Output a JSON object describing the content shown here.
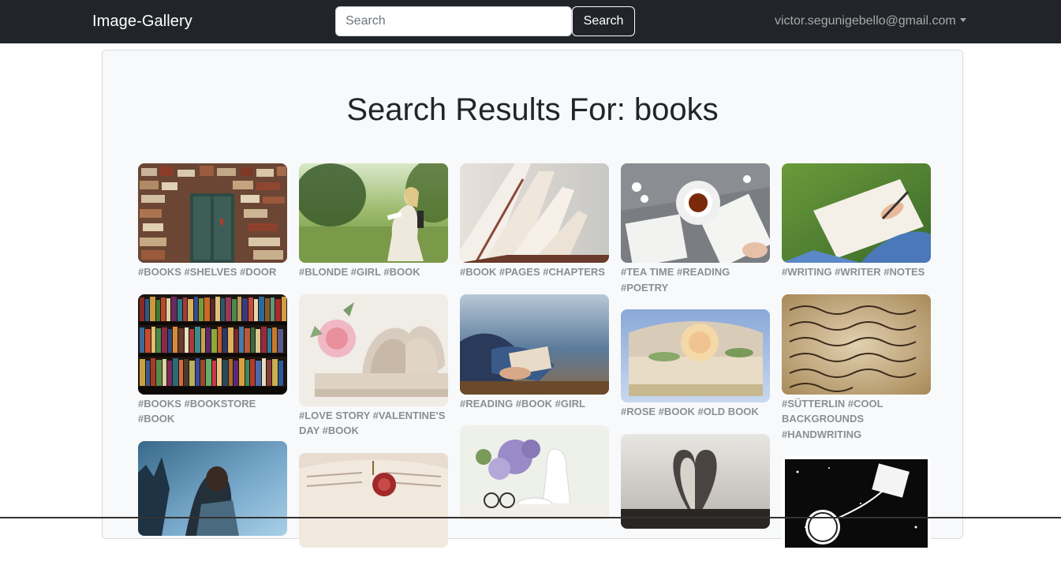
{
  "navbar": {
    "brand": "Image-Gallery",
    "search_placeholder": "Search",
    "search_button": "Search",
    "user_email": "victor.segunigebello@gmail.com"
  },
  "page": {
    "title": "Search Results For: books"
  },
  "columns": [
    [
      {
        "tags": "#BOOKS #SHELVES #DOOR"
      },
      {
        "tags": "#BOOKS #BOOKSTORE #BOOK"
      },
      {
        "tags": ""
      }
    ],
    [
      {
        "tags": "#BLONDE #GIRL #BOOK"
      },
      {
        "tags": "#LOVE STORY #VALENTINE'S DAY #BOOK"
      },
      {
        "tags": ""
      }
    ],
    [
      {
        "tags": "#BOOK #PAGES #CHAPTERS"
      },
      {
        "tags": "#READING #BOOK #GIRL"
      },
      {
        "tags": ""
      }
    ],
    [
      {
        "tags": "#TEA TIME #READING #POETRY"
      },
      {
        "tags": "#ROSE #BOOK #OLD BOOK"
      },
      {
        "tags": ""
      }
    ],
    [
      {
        "tags": "#WRITING #WRITER #NOTES"
      },
      {
        "tags": "#SÜTTERLIN #COOL BACKGROUNDS #HANDWRITING"
      },
      {
        "tags": ""
      }
    ]
  ]
}
